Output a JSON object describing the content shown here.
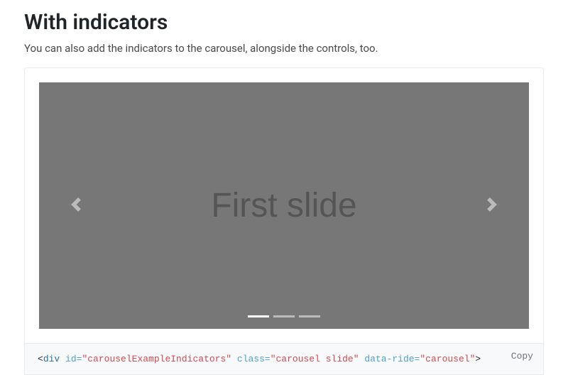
{
  "section": {
    "title": "With indicators",
    "description": "You can also add the indicators to the carousel, alongside the controls, too."
  },
  "carousel": {
    "slide_text": "First slide",
    "prev_label": "Previous",
    "next_label": "Next",
    "active_indicator": 0,
    "indicator_count": 3
  },
  "code": {
    "copy_label": "Copy",
    "tag_open": "<",
    "tag_name": "div",
    "attr_id": "id=",
    "val_id": "\"carouselExampleIndicators\"",
    "attr_class": "class=",
    "val_class": "\"carousel slide\"",
    "attr_ride": "data-ride=",
    "val_ride": "\"carousel\"",
    "tag_close": ">"
  }
}
